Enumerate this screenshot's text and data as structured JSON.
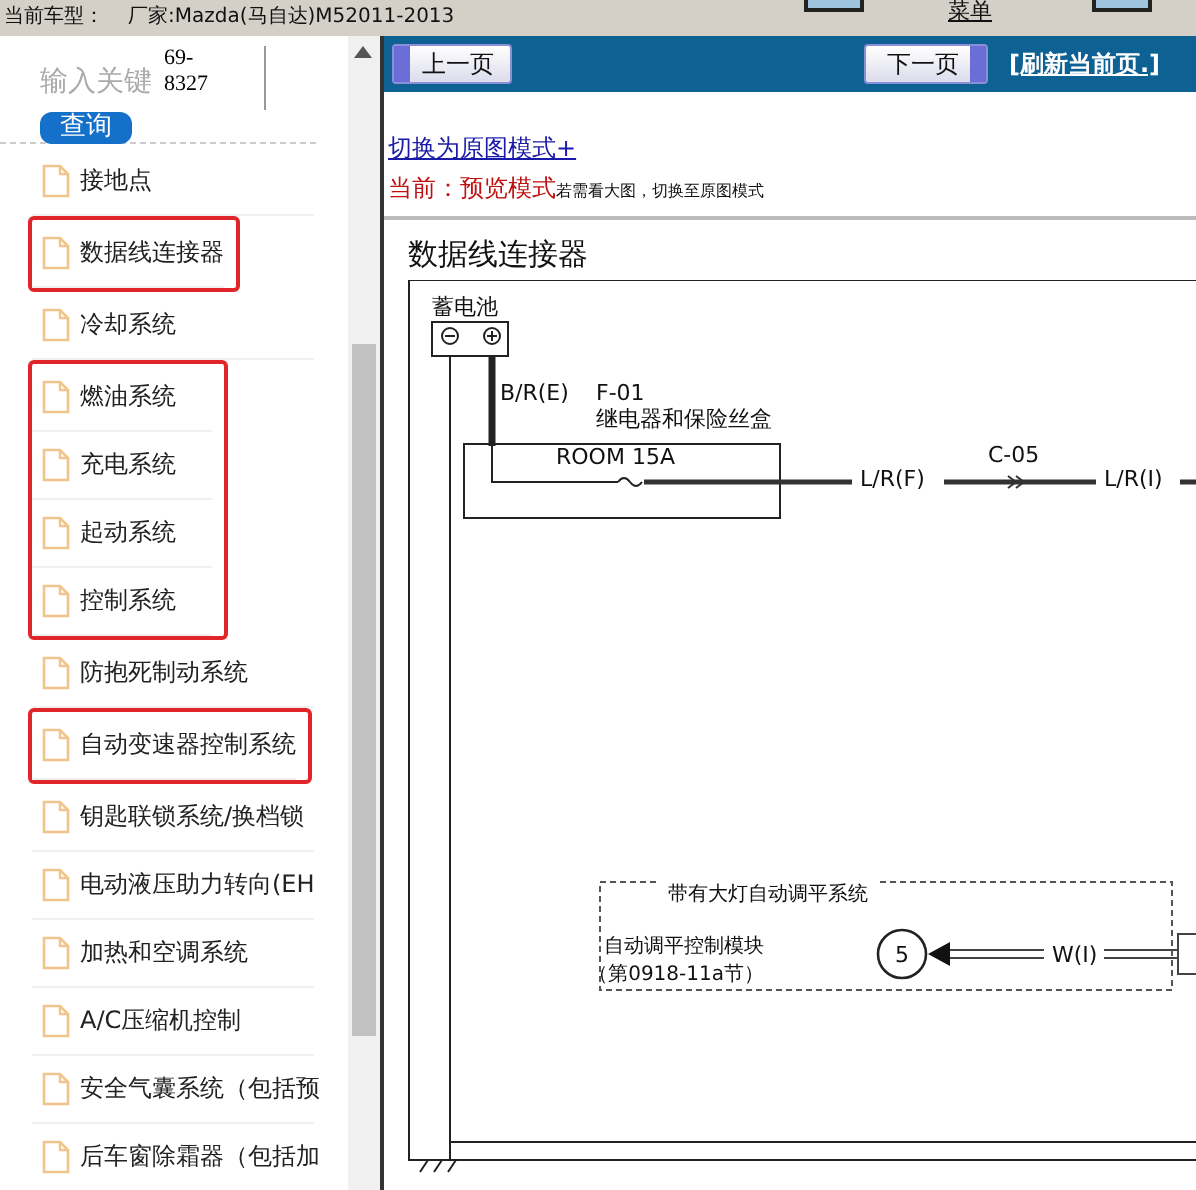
{
  "top_bar": {
    "vehicle_label": "当前车型：",
    "vehicle": "厂家:Mazda(马自达)M52011-2013",
    "menu_link": "菜单"
  },
  "search": {
    "placeholder": "输入关键",
    "value": "69-\n8327",
    "button": "查询"
  },
  "sidebar": {
    "items": [
      {
        "label": "接地点",
        "annotated": false
      },
      {
        "label": "数据线连接器",
        "annotated": true
      },
      {
        "label": "冷却系统",
        "annotated": false
      },
      {
        "label": "燃油系统",
        "annotated": true
      },
      {
        "label": "充电系统",
        "annotated": true
      },
      {
        "label": "起动系统",
        "annotated": true
      },
      {
        "label": "控制系统",
        "annotated": true
      },
      {
        "label": "防抱死制动系统",
        "annotated": false
      },
      {
        "label": "自动变速器控制系统",
        "annotated": true
      },
      {
        "label": "钥匙联锁系统/换档锁",
        "annotated": false
      },
      {
        "label": "电动液压助力转向(EH",
        "annotated": false
      },
      {
        "label": "加热和空调系统",
        "annotated": false
      },
      {
        "label": "A/C压缩机控制",
        "annotated": false
      },
      {
        "label": "安全气囊系统（包括预",
        "annotated": false
      },
      {
        "label": "后车窗除霜器（包括加",
        "annotated": false
      }
    ]
  },
  "nav": {
    "prev": "上一页",
    "next": "下一页",
    "refresh": "[刷新当前页.]"
  },
  "mode": {
    "switch_link": "切换为原图模式+",
    "current_label": "当前：预览模式",
    "hint": "若需看大图，切换至原图模式"
  },
  "diagram": {
    "title": "数据线连接器",
    "texts": [
      {
        "kind": "battery",
        "text": "蓄电池"
      },
      {
        "kind": "wire_be",
        "text": "B/R(E)"
      },
      {
        "kind": "f01",
        "text": "F-01"
      },
      {
        "kind": "fusebox",
        "text": "继电器和保险丝盒"
      },
      {
        "kind": "room",
        "text": "ROOM 15A"
      },
      {
        "kind": "lrf",
        "text": "L/R(F)"
      },
      {
        "kind": "c05",
        "text": "C-05"
      },
      {
        "kind": "lri",
        "text": "L/R(I)"
      },
      {
        "kind": "system",
        "text": "带有大灯自动调平系统"
      },
      {
        "kind": "module",
        "text": "自动调平控制模块"
      },
      {
        "kind": "section",
        "text": "（第0918-11a节）"
      },
      {
        "kind": "pin",
        "text": "5"
      },
      {
        "kind": "wi",
        "text": "W(I)"
      }
    ]
  }
}
